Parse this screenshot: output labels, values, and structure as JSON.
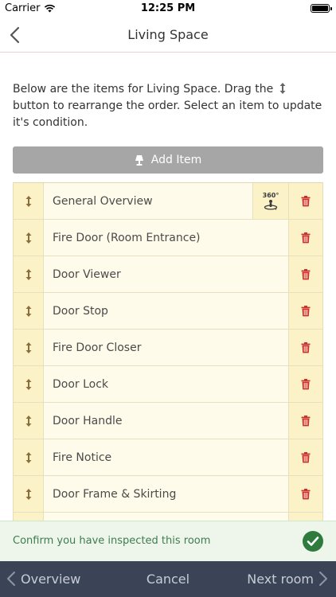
{
  "status_bar": {
    "carrier": "Carrier",
    "time": "12:25 PM",
    "battery_level": 1.0
  },
  "nav": {
    "title": "Living Space",
    "back_icon": "chevron-left-icon"
  },
  "instructions": {
    "before_icon": "Below are the items for Living Space. Drag the",
    "after_icon": "button to rearrange the order. Select an item to update it's condition."
  },
  "add_item": {
    "label": "Add Item",
    "icon": "lamp-icon"
  },
  "items": [
    {
      "label": "General Overview",
      "has_360": true
    },
    {
      "label": "Fire Door (Room Entrance)",
      "has_360": false
    },
    {
      "label": "Door Viewer",
      "has_360": false
    },
    {
      "label": "Door Stop",
      "has_360": false
    },
    {
      "label": "Fire Door Closer",
      "has_360": false
    },
    {
      "label": "Door Lock",
      "has_360": false
    },
    {
      "label": "Door Handle",
      "has_360": false
    },
    {
      "label": "Fire Notice",
      "has_360": false
    },
    {
      "label": "Door Frame & Skirting",
      "has_360": false
    },
    {
      "label": "",
      "has_360": false
    }
  ],
  "pano_label": "360°",
  "confirm": {
    "text": "Confirm you have inspected this room",
    "icon": "check-circle-icon"
  },
  "toolbar": {
    "overview": "Overview",
    "cancel": "Cancel",
    "next": "Next room"
  },
  "colors": {
    "accent_brown": "#8a6d3b",
    "trash_red": "#c9302c",
    "confirm_green": "#2f7b3d",
    "toolbar_bg": "#3b4457",
    "add_button_bg": "#a6a6a6"
  }
}
